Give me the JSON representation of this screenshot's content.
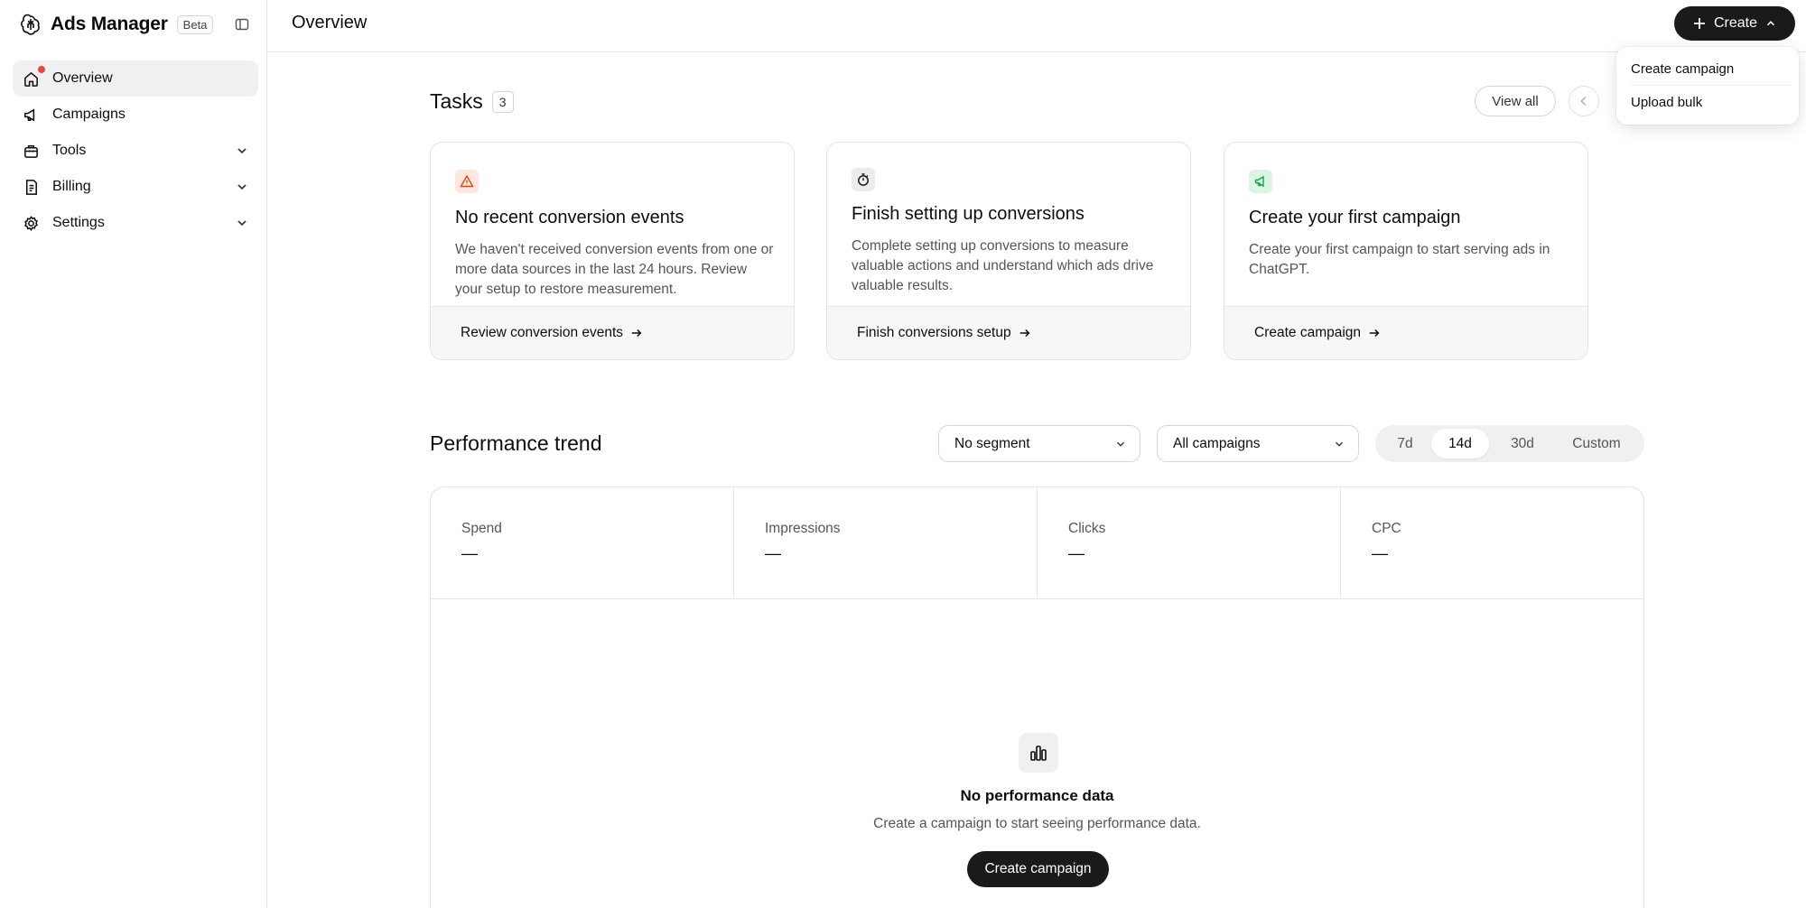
{
  "app": {
    "title": "Ads Manager",
    "badge": "Beta"
  },
  "sidebar": {
    "items": [
      {
        "label": "Overview",
        "icon": "home-icon",
        "active": true,
        "notification": true
      },
      {
        "label": "Campaigns",
        "icon": "megaphone-icon"
      },
      {
        "label": "Tools",
        "icon": "toolbox-icon",
        "expandable": true
      },
      {
        "label": "Billing",
        "icon": "receipt-icon",
        "expandable": true
      },
      {
        "label": "Settings",
        "icon": "gear-icon",
        "expandable": true
      }
    ]
  },
  "header": {
    "title": "Overview",
    "create_label": "Create"
  },
  "create_menu": {
    "items": [
      "Create campaign",
      "Upload bulk"
    ]
  },
  "tasks": {
    "title": "Tasks",
    "count": "3",
    "view_all": "View all",
    "cards": [
      {
        "icon": "warning-icon",
        "title": "No recent conversion events",
        "description": "We haven't received conversion events from one or more data sources in the last 24 hours. Review your setup to restore measurement.",
        "action": "Review conversion events"
      },
      {
        "icon": "stopwatch-icon",
        "title": "Finish setting up conversions",
        "description": "Complete setting up conversions to measure valuable actions and understand which ads drive valuable results.",
        "action": "Finish conversions setup"
      },
      {
        "icon": "megaphone-icon",
        "title": "Create your first campaign",
        "description": "Create your first campaign to start serving ads in ChatGPT.",
        "action": "Create campaign"
      }
    ]
  },
  "performance": {
    "title": "Performance trend",
    "segment_select": "No segment",
    "campaign_select": "All campaigns",
    "ranges": [
      "7d",
      "14d",
      "30d",
      "Custom"
    ],
    "selected_range": "14d",
    "metrics": [
      {
        "label": "Spend",
        "value": "—"
      },
      {
        "label": "Impressions",
        "value": "—"
      },
      {
        "label": "Clicks",
        "value": "—"
      },
      {
        "label": "CPC",
        "value": "—"
      }
    ],
    "empty": {
      "title": "No performance data",
      "description": "Create a campaign to start seeing performance data.",
      "button": "Create campaign"
    }
  },
  "colors": {
    "accent_dark": "#1a1a1a",
    "notification": "#ef4444",
    "warning_bg": "#fde8e0",
    "warning_fg": "#d9480f",
    "success_bg": "#dcf5e3",
    "success_fg": "#16a34a",
    "neutral_bg": "#ececec"
  }
}
